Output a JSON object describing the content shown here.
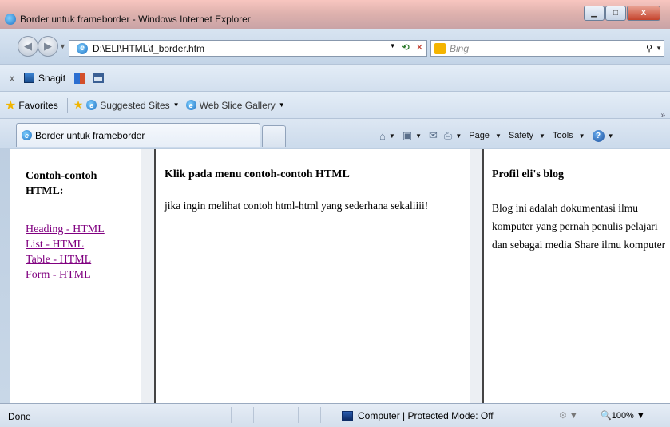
{
  "window": {
    "title": "Border untuk frameborder - Windows Internet Explorer",
    "buttons": {
      "minimize": "▁",
      "maximize": "□",
      "close": "X"
    }
  },
  "address_bar": {
    "url": "D:\\ELI\\HTML\\f_border.htm",
    "search_placeholder": "Bing"
  },
  "snagit_bar": {
    "close": "x",
    "label": "Snagit"
  },
  "favorites_bar": {
    "favorites_label": "Favorites",
    "items": [
      "Suggested Sites",
      "Web Slice Gallery"
    ]
  },
  "tabs": [
    {
      "label": "Border untuk frameborder"
    }
  ],
  "command_bar": {
    "page": "Page",
    "safety": "Safety",
    "tools": "Tools"
  },
  "frames": {
    "left": {
      "heading": "Contoh-contoh HTML:",
      "links": [
        "Heading - HTML",
        "List - HTML",
        "Table - HTML",
        "Form - HTML"
      ]
    },
    "middle": {
      "heading": "Klik pada menu contoh-contoh HTML",
      "text": "jika ingin melihat contoh html-html yang sederhana sekaliiii!"
    },
    "right": {
      "heading": "Profil eli's blog",
      "text": "Blog ini adalah dokumentasi ilmu komputer yang pernah penulis pelajari dan sebagai media Share ilmu komputer"
    }
  },
  "status_bar": {
    "status": "Done",
    "zone": "Computer | Protected Mode: Off",
    "zoom": "100%"
  }
}
